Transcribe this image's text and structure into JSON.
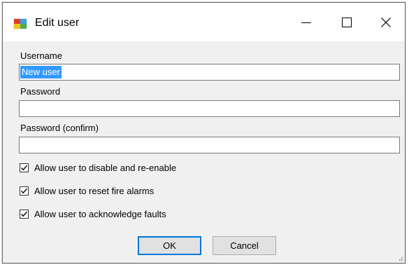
{
  "window": {
    "title": "Edit user",
    "controls": {
      "minimize": "minimize",
      "maximize": "maximize",
      "close": "close"
    }
  },
  "form": {
    "username_label": "Username",
    "username_value": "New user",
    "password_label": "Password",
    "password_value": "",
    "password_confirm_label": "Password (confirm)",
    "password_confirm_value": ""
  },
  "options": [
    {
      "label": "Allow user to disable and re-enable",
      "checked": true
    },
    {
      "label": "Allow user to reset fire alarms",
      "checked": true
    },
    {
      "label": "Allow user to acknowledge faults",
      "checked": true
    }
  ],
  "buttons": {
    "ok": "OK",
    "cancel": "Cancel"
  },
  "colors": {
    "accent": "#0078d7",
    "selection": "#3399ff",
    "dialog_bg": "#f0f0f0",
    "titlebar_bg": "#ffffff"
  }
}
